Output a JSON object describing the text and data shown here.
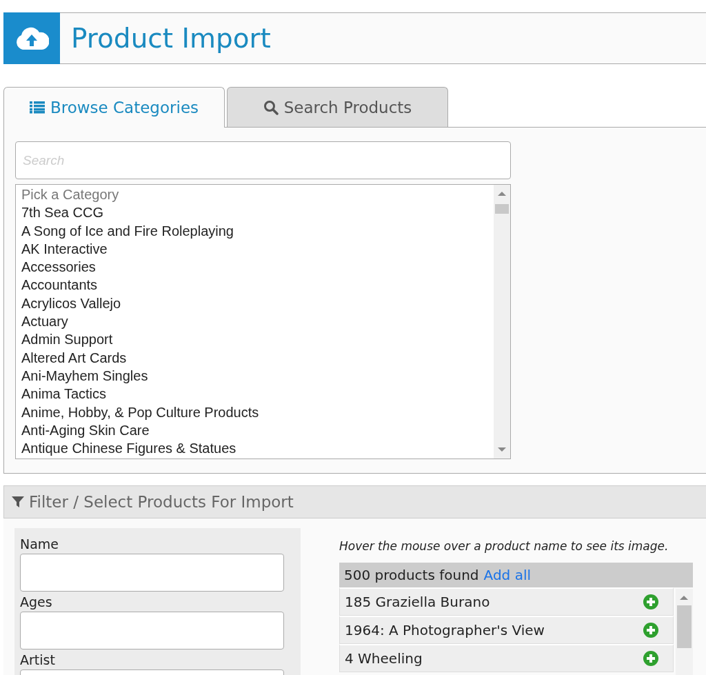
{
  "header": {
    "title": "Product Import"
  },
  "tabs": [
    {
      "label": "Browse Categories",
      "selected": true
    },
    {
      "label": "Search Products",
      "selected": false
    }
  ],
  "category_search": {
    "placeholder": "Search"
  },
  "category_list": {
    "placeholder": "Pick a Category",
    "items": [
      "7th Sea CCG",
      "A Song of Ice and Fire Roleplaying",
      "AK Interactive",
      "Accessories",
      "Accountants",
      "Acrylicos Vallejo",
      "Actuary",
      "Admin Support",
      "Altered Art Cards",
      "Ani-Mayhem Singles",
      "Anima Tactics",
      "Anime, Hobby, & Pop Culture Products",
      "Anti-Aging Skin Care",
      "Antique Chinese Figures & Statues"
    ]
  },
  "filter": {
    "title": "Filter / Select Products For Import",
    "fields": [
      {
        "label": "Name"
      },
      {
        "label": "Ages"
      },
      {
        "label": "Artist"
      }
    ],
    "hint": "Hover the mouse over a product name to see its image.",
    "results": {
      "count": "500 products found",
      "add_all": "Add all",
      "products": [
        "185 Graziella Burano",
        "1964: A Photographer's View",
        "4 Wheeling"
      ]
    }
  }
}
